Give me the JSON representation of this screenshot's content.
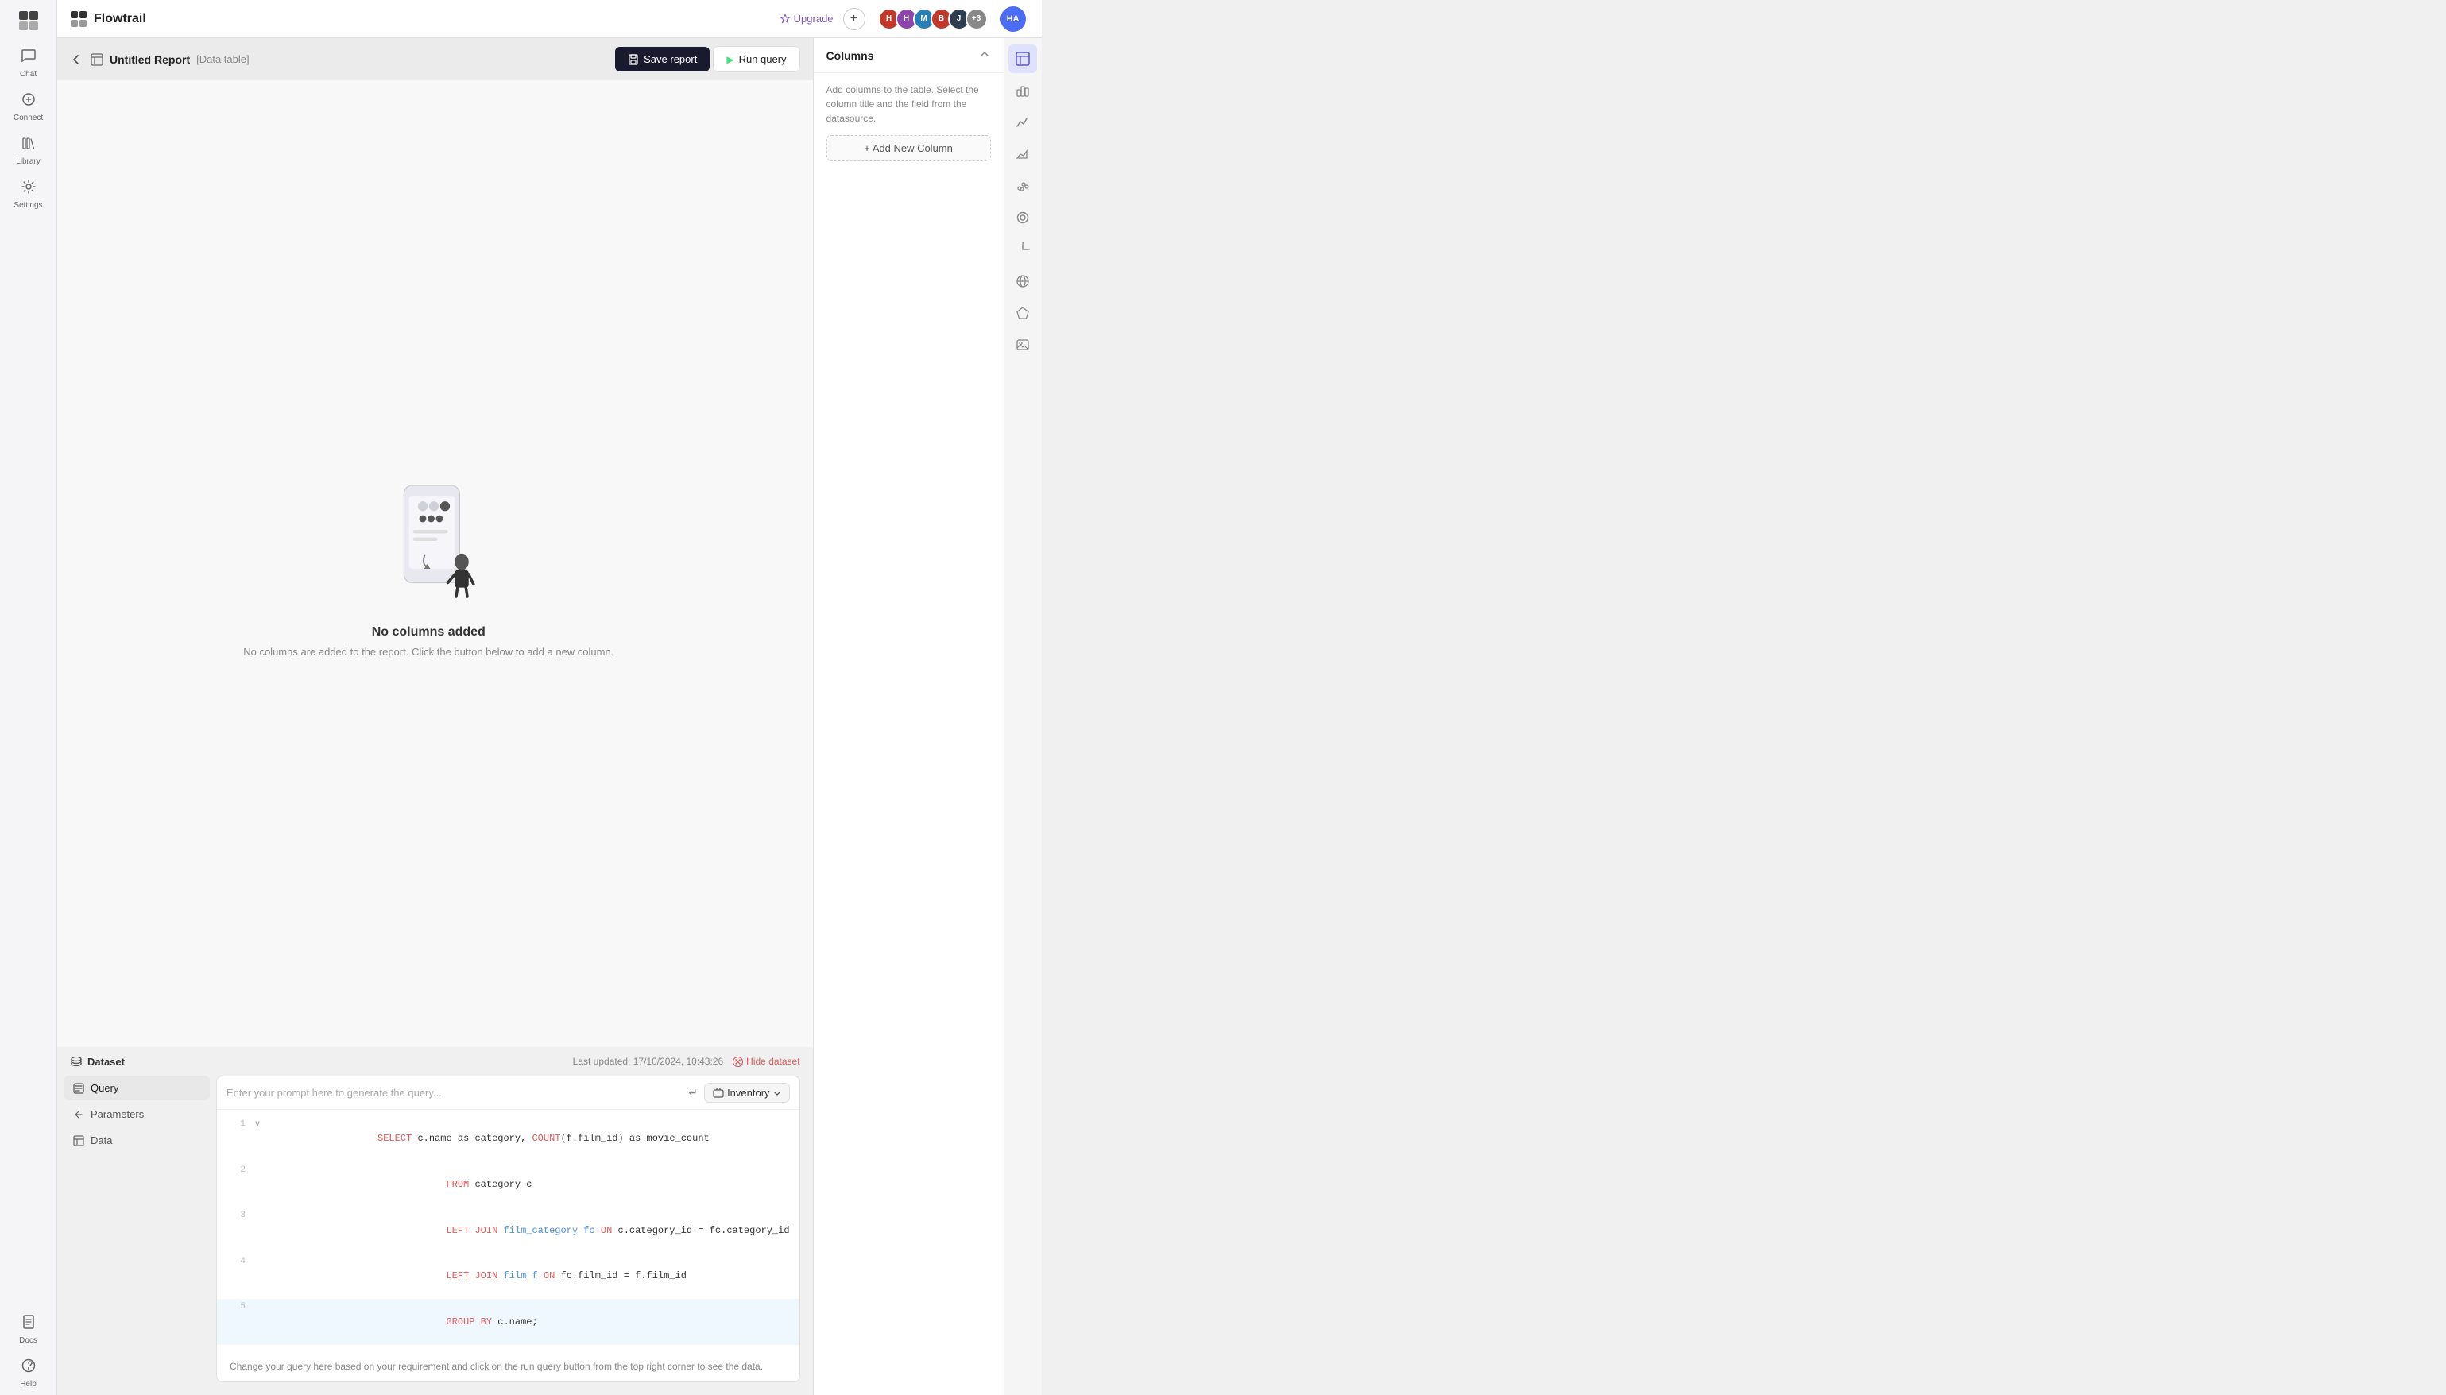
{
  "app": {
    "name": "Flowtrail",
    "logo_symbol": "⬡"
  },
  "topbar": {
    "upgrade_label": "Upgrade",
    "ha_label": "HA"
  },
  "nav": {
    "items": [
      {
        "id": "chat",
        "label": "Chat",
        "icon": "💬"
      },
      {
        "id": "connect",
        "label": "Connect",
        "icon": "🔌"
      },
      {
        "id": "library",
        "label": "Library",
        "icon": "📚"
      },
      {
        "id": "settings",
        "label": "Settings",
        "icon": "⚙️"
      }
    ],
    "bottom_items": [
      {
        "id": "docs",
        "label": "Docs",
        "icon": "📄"
      },
      {
        "id": "help",
        "label": "Help",
        "icon": "❓"
      }
    ]
  },
  "report": {
    "title": "Untitled Report",
    "tag": "[Data table]",
    "save_btn": "Save report",
    "run_btn": "Run query"
  },
  "empty_state": {
    "title": "No columns added",
    "subtitle": "No columns are added to the report. Click the button below to add a new column."
  },
  "dataset": {
    "title": "Dataset",
    "last_updated": "Last updated: 17/10/2024, 10:43:26",
    "hide_btn": "Hide dataset",
    "nav_items": [
      {
        "id": "query",
        "label": "Query",
        "icon": "≡",
        "active": true
      },
      {
        "id": "parameters",
        "label": "Parameters",
        "icon": "⚡"
      },
      {
        "id": "data",
        "label": "Data",
        "icon": "⊞"
      }
    ],
    "prompt_placeholder": "Enter your prompt here to generate the query...",
    "datasource": "Inventory",
    "query_hint": "Change your query here based on your requirement and click on the run query button from the top right corner to see the data.",
    "code_lines": [
      {
        "num": "1",
        "indicator": "v",
        "content": "SELECT c.name as category, COUNT(f.film_id) as movie_count",
        "parts": [
          {
            "text": "SELECT ",
            "class": "kw-red"
          },
          {
            "text": "c.name as category, ",
            "class": "kw-dark"
          },
          {
            "text": "COUNT",
            "class": "kw-red"
          },
          {
            "text": "(f.film_id) as movie_count",
            "class": "kw-dark"
          }
        ]
      },
      {
        "num": "2",
        "indicator": "",
        "content": "            FROM category c",
        "parts": [
          {
            "text": "            "
          },
          {
            "text": "FROM ",
            "class": "kw-red"
          },
          {
            "text": "category c",
            "class": "kw-dark"
          }
        ]
      },
      {
        "num": "3",
        "indicator": "",
        "content": "            LEFT JOIN film_category fc ON c.category_id = fc.category_id",
        "parts": [
          {
            "text": "            "
          },
          {
            "text": "LEFT JOIN ",
            "class": "kw-red"
          },
          {
            "text": "film_category fc ",
            "class": "kw-blue"
          },
          {
            "text": "ON c.category_id = fc.category_id",
            "class": "kw-dark"
          }
        ]
      },
      {
        "num": "4",
        "indicator": "",
        "content": "            LEFT JOIN film f ON fc.film_id = f.film_id",
        "parts": [
          {
            "text": "            "
          },
          {
            "text": "LEFT JOIN ",
            "class": "kw-red"
          },
          {
            "text": "film f ",
            "class": "kw-blue"
          },
          {
            "text": "ON fc.film_id = f.film_id",
            "class": "kw-dark"
          }
        ]
      },
      {
        "num": "5",
        "indicator": "",
        "content": "            GROUP BY c.name;",
        "parts": [
          {
            "text": "            "
          },
          {
            "text": "GROUP BY ",
            "class": "kw-red"
          },
          {
            "text": "c.name;",
            "class": "kw-dark"
          }
        ],
        "active": true
      }
    ]
  },
  "columns_panel": {
    "title": "Columns",
    "description": "Add columns to the table. Select the column title and the field from the datasource.",
    "add_btn": "+ Add New Column"
  },
  "right_icon_bar": {
    "icons": [
      {
        "id": "table",
        "symbol": "⊞",
        "active": true
      },
      {
        "id": "bar-chart",
        "symbol": "📊"
      },
      {
        "id": "line-chart",
        "symbol": "📈"
      },
      {
        "id": "area-chart",
        "symbol": "📉"
      },
      {
        "id": "scatter",
        "symbol": "🔵"
      },
      {
        "id": "donut",
        "symbol": "⭕"
      },
      {
        "id": "pie",
        "symbol": "◑"
      },
      {
        "id": "globe",
        "symbol": "🌐"
      },
      {
        "id": "pentagon",
        "symbol": "⬠"
      },
      {
        "id": "image",
        "symbol": "🖼"
      }
    ]
  },
  "avatars": [
    {
      "initials": "H",
      "color": "#c0392b"
    },
    {
      "initials": "H",
      "color": "#8e44ad"
    },
    {
      "initials": "M",
      "color": "#2980b9"
    },
    {
      "initials": "B",
      "color": "#c0392b"
    },
    {
      "initials": "J",
      "color": "#2c3e50"
    }
  ],
  "avatar_more": "+3"
}
